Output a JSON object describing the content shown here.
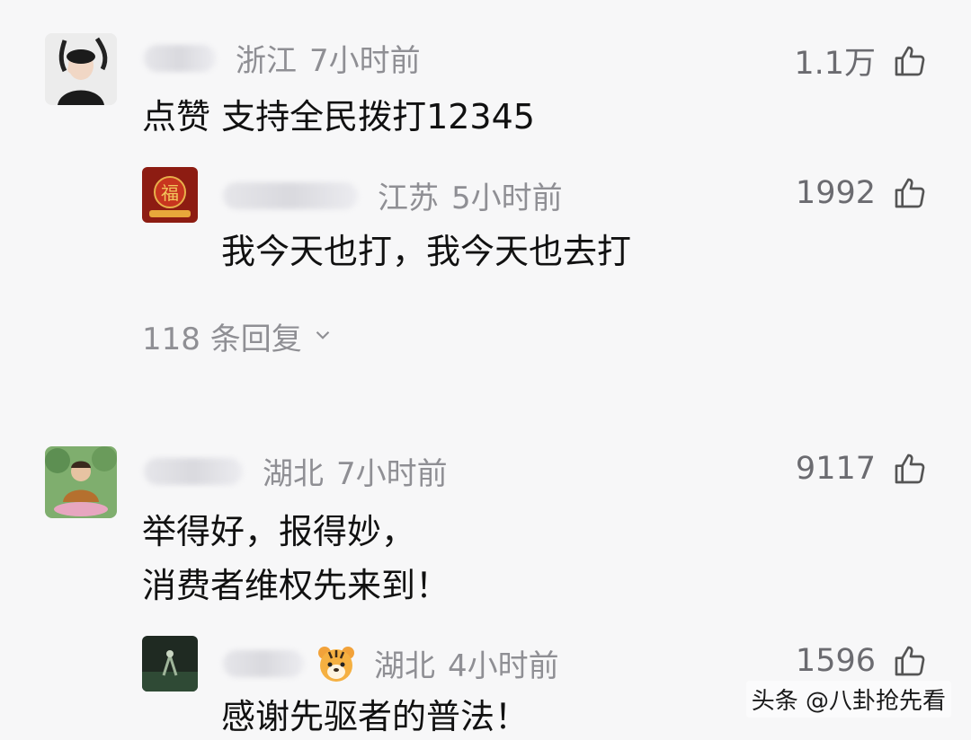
{
  "comments": [
    {
      "location": "浙江",
      "time": "7小时前",
      "likes": "1.1万",
      "text": "点赞 支持全民拨打12345",
      "reply": {
        "location": "江苏",
        "time": "5小时前",
        "likes": "1992",
        "text": "我今天也打，我今天也去打"
      },
      "more_replies": "118 条回复"
    },
    {
      "location": "湖北",
      "time": "7小时前",
      "likes": "9117",
      "text_lines": [
        "举得好，报得妙，",
        "消费者维权先来到！"
      ],
      "reply": {
        "location": "湖北",
        "time": "4小时前",
        "likes": "1596",
        "text": "感谢先驱者的普法！"
      }
    }
  ],
  "watermark": "头条 @八卦抢先看",
  "colors": {
    "background": "#f7f7f8",
    "meta_text": "#8f8f94",
    "body_text": "#111111"
  }
}
